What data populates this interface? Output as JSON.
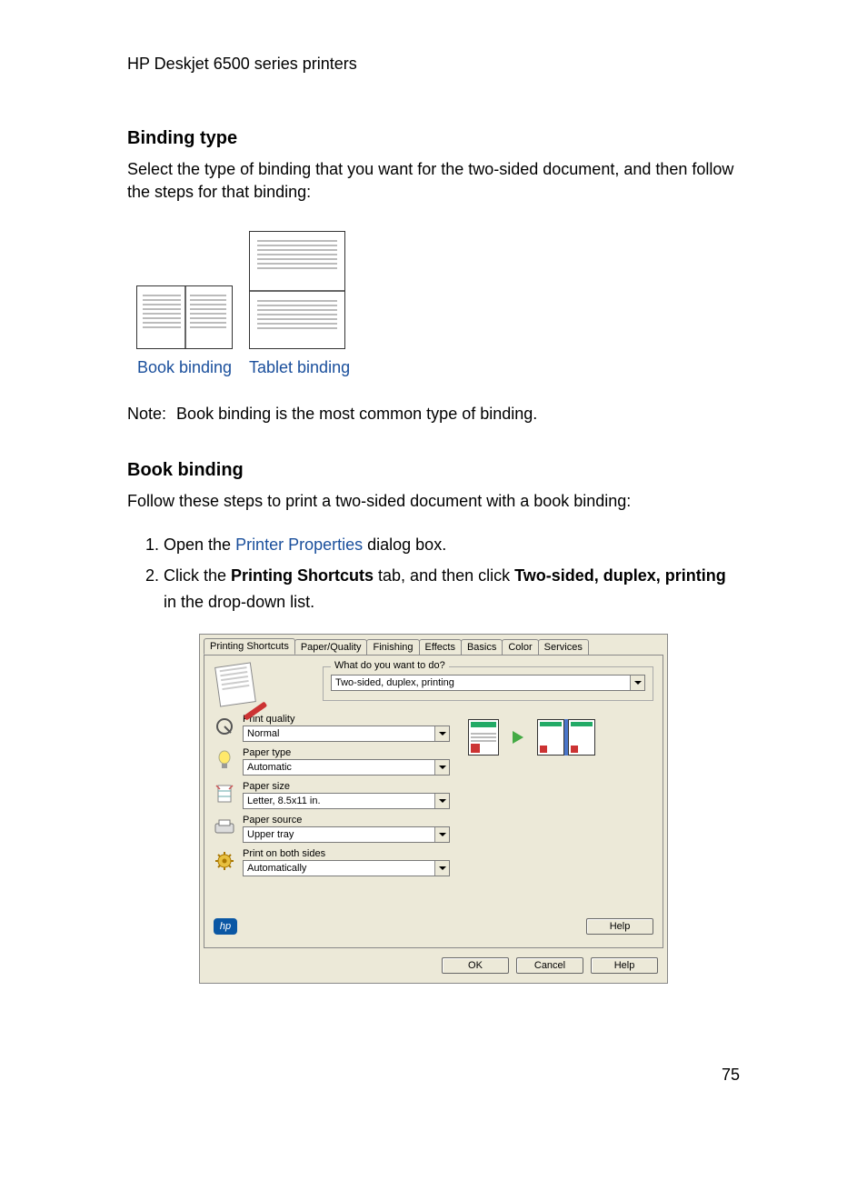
{
  "header": "HP Deskjet 6500 series printers",
  "section_binding_type": {
    "title": "Binding type",
    "intro": "Select the type of binding that you want for the two-sided document, and then follow the steps for that binding:",
    "options": {
      "book": "Book binding",
      "tablet": "Tablet binding"
    },
    "note_label": "Note:",
    "note_text": "Book binding is the most common type of binding."
  },
  "section_book_binding": {
    "title": "Book binding",
    "intro": "Follow these steps to print a two-sided document with a book binding:",
    "step1_pre": "Open the ",
    "step1_link": "Printer Properties",
    "step1_post": " dialog box.",
    "step2_pre": "Click the ",
    "step2_b1": "Printing Shortcuts",
    "step2_mid": " tab, and then click ",
    "step2_b2": "Two-sided, duplex, printing",
    "step2_post": " in the drop-down list."
  },
  "dialog": {
    "tabs": [
      "Printing Shortcuts",
      "Paper/Quality",
      "Finishing",
      "Effects",
      "Basics",
      "Color",
      "Services"
    ],
    "active_tab": 0,
    "question_legend": "What do you want to do?",
    "question_value": "Two-sided, duplex, printing",
    "fields": {
      "print_quality": {
        "label": "Print quality",
        "value": "Normal"
      },
      "paper_type": {
        "label": "Paper type",
        "value": "Automatic"
      },
      "paper_size": {
        "label": "Paper size",
        "value": "Letter, 8.5x11 in."
      },
      "paper_source": {
        "label": "Paper source",
        "value": "Upper tray"
      },
      "duplex": {
        "label": "Print on both sides",
        "value": "Automatically"
      }
    },
    "logo_text": "hp",
    "inner_help": "Help",
    "buttons": {
      "ok": "OK",
      "cancel": "Cancel",
      "help": "Help"
    }
  },
  "page_number": "75"
}
